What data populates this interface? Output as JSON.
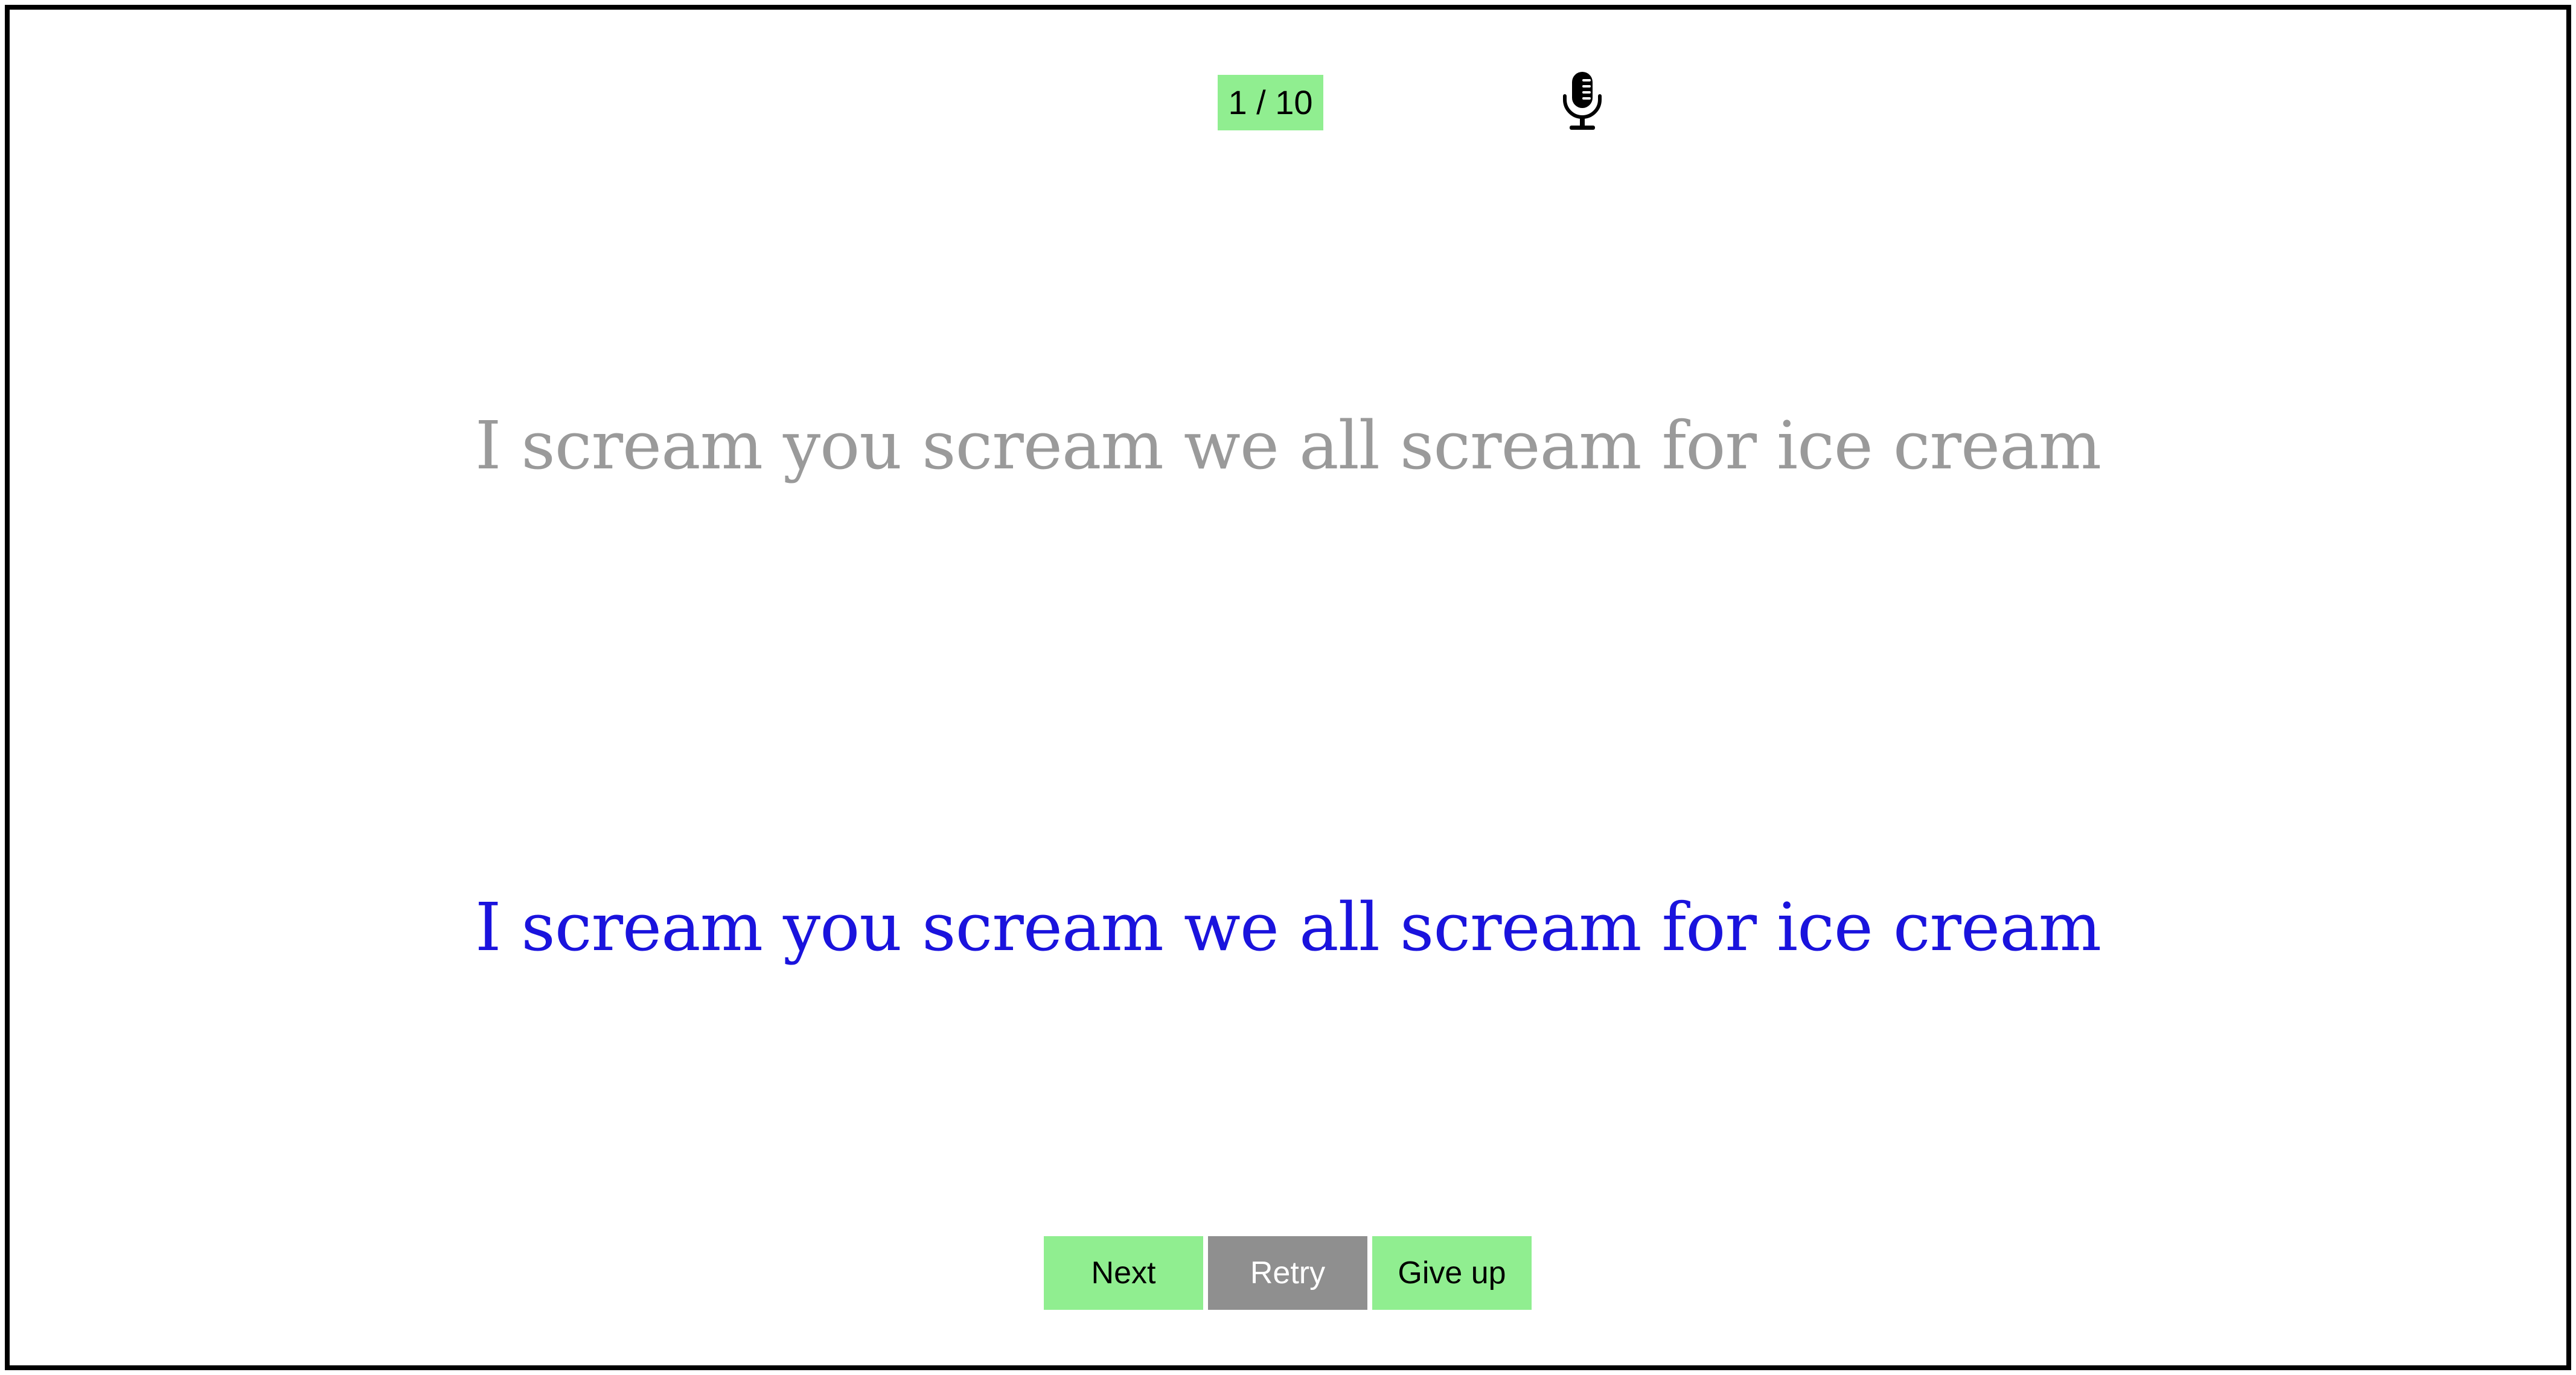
{
  "header": {
    "progress_label": "1 / 10",
    "mic_icon": "microphone-icon"
  },
  "exercise": {
    "prompt_text": "I scream you scream we all scream for ice cream",
    "answer_text": "I scream you scream we all scream for ice cream"
  },
  "controls": {
    "next_label": "Next",
    "retry_label": "Retry",
    "give_up_label": "Give up"
  },
  "colors": {
    "green": "#90ee90",
    "gray_button": "#8f8f8f",
    "prompt_text": "#9a9a9a",
    "answer_text": "#1a13dd",
    "border": "#000000"
  }
}
